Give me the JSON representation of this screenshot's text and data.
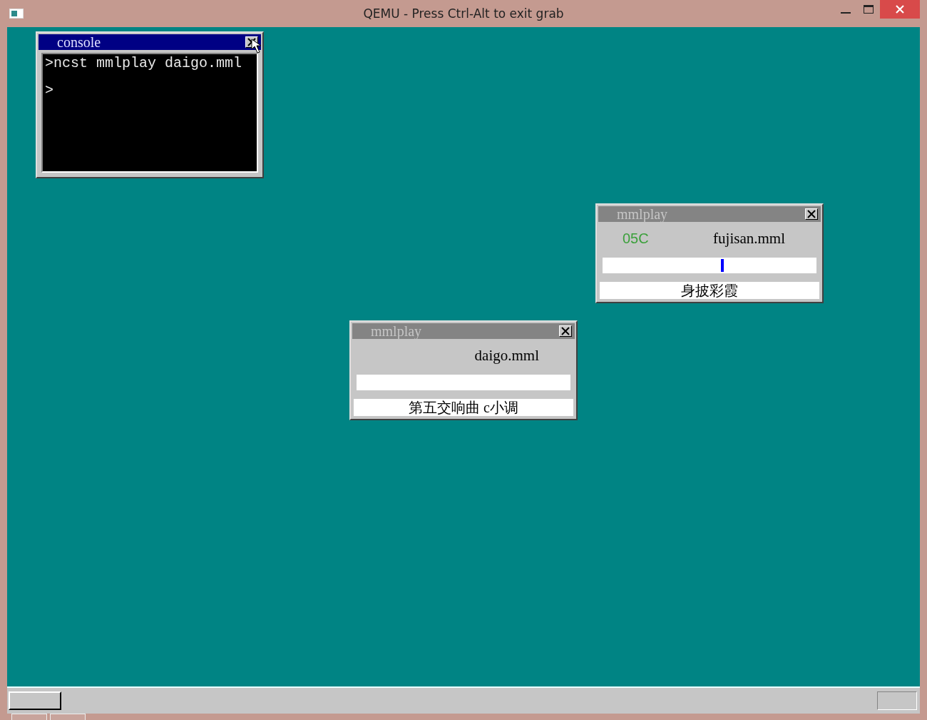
{
  "window": {
    "title": "QEMU - Press Ctrl-Alt to exit grab"
  },
  "console": {
    "title": "console",
    "active": true,
    "lines": [
      ">ncst mmlplay daigo.mml",
      ">"
    ]
  },
  "players": [
    {
      "title": "mmlplay",
      "active": false,
      "note": "05C",
      "file": "fujisan.mml",
      "level": 0.56,
      "song": "身披彩霞"
    },
    {
      "title": "mmlplay",
      "active": false,
      "file": "daigo.mml",
      "song": "第五交响曲 c小调"
    }
  ]
}
